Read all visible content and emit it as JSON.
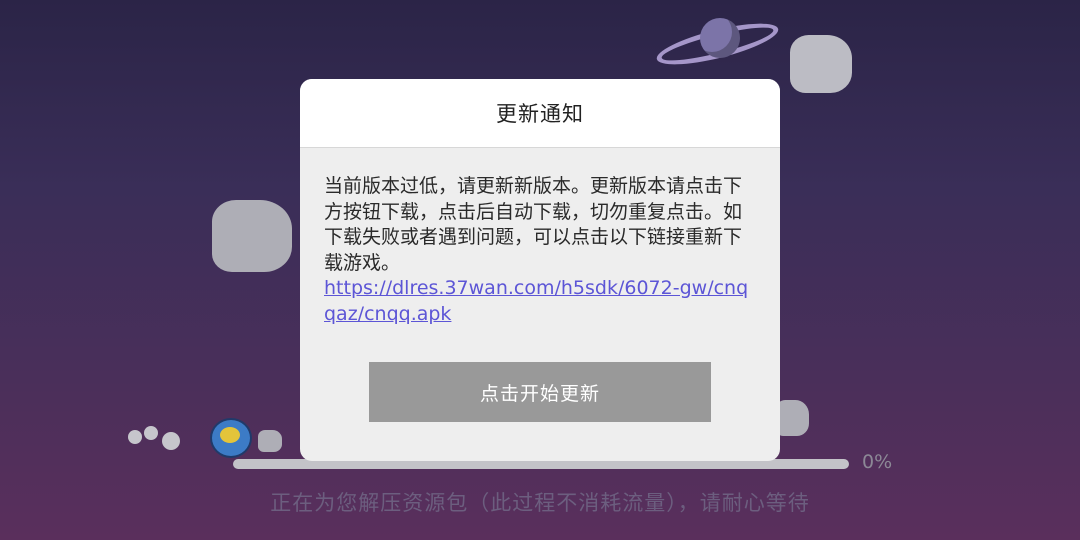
{
  "dialog": {
    "title": "更新通知",
    "message": "当前版本过低，请更新新版本。更新版本请点击下方按钮下载，点击后自动下载，切勿重复点击。如下载失败或者遇到问题，可以点击以下链接重新下载游戏。",
    "link": "https://dlres.37wan.com/h5sdk/6072-gw/cnqqaz/cnqq.apk",
    "button_label": "点击开始更新"
  },
  "loading": {
    "percent_text": "0%",
    "progress": 0,
    "status_text": "正在为您解压资源包（此过程不消耗流量），请耐心等待"
  }
}
